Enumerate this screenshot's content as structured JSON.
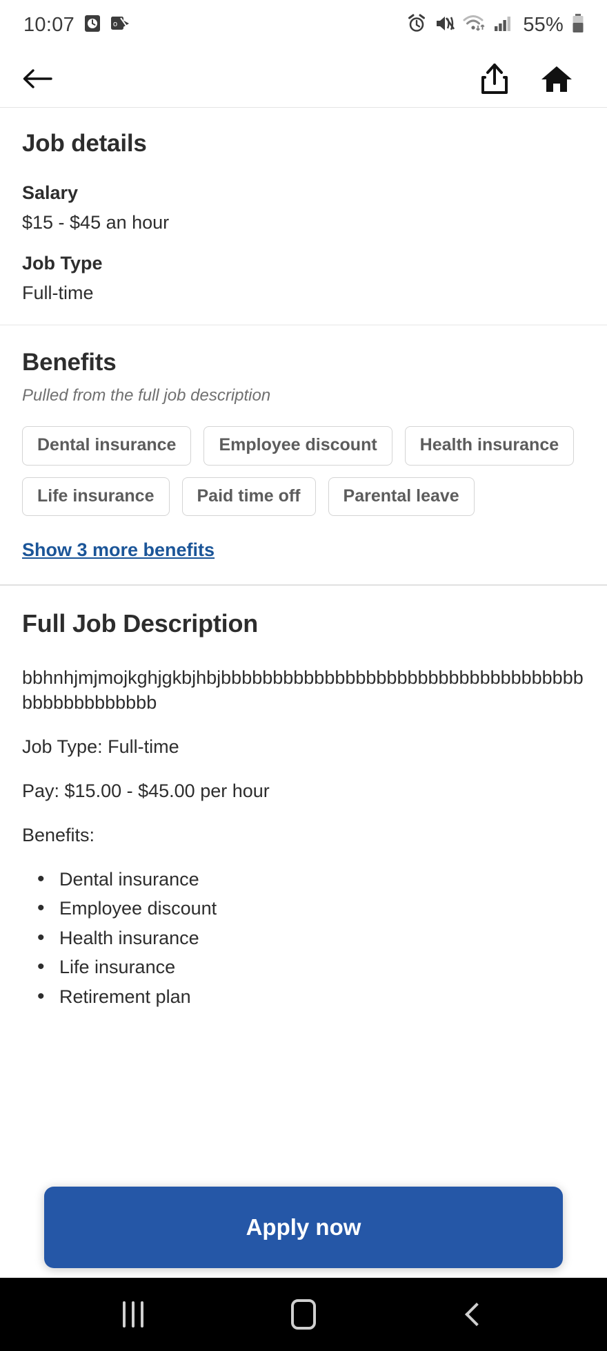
{
  "status_bar": {
    "time": "10:07",
    "battery_percent": "55%",
    "left_icons": [
      "clock-badge-icon",
      "outlook-mail-icon"
    ],
    "right_icons": [
      "alarm-icon",
      "mute-vibrate-icon",
      "wifi-icon",
      "cellular-signal-icon",
      "battery-icon"
    ]
  },
  "app_bar": {
    "back_label": "Back",
    "share_label": "Share",
    "home_label": "Home"
  },
  "job_details": {
    "title": "Job details",
    "fields": [
      {
        "label": "Salary",
        "value": "$15 - $45 an hour"
      },
      {
        "label": "Job Type",
        "value": "Full-time"
      }
    ]
  },
  "benefits": {
    "title": "Benefits",
    "subtitle": "Pulled from the full job description",
    "chips": [
      "Dental insurance",
      "Employee discount",
      "Health insurance",
      "Life insurance",
      "Paid time off",
      "Parental leave"
    ],
    "show_more_label": "Show 3 more benefits"
  },
  "full_description": {
    "title": "Full Job Description",
    "gibberish": "bbhnhjmjmojkghjgkbjhbjbbbbbbbbbbbbbbbbbbbbbbbbbbbbbbbbbbbbbbbbbbbbbbbb",
    "job_type_line": "Job Type: Full-time",
    "pay_line": "Pay: $15.00 - $45.00 per hour",
    "benefits_heading": "Benefits:",
    "benefits_list": [
      "Dental insurance",
      "Employee discount",
      "Health insurance",
      "Life insurance",
      "Retirement plan"
    ]
  },
  "apply": {
    "label": "Apply now",
    "color": "#2557a7"
  },
  "link_color": "#1b5598",
  "nav_bar": {
    "recents_label": "Recent apps",
    "home_label": "Home",
    "back_label": "Back"
  }
}
